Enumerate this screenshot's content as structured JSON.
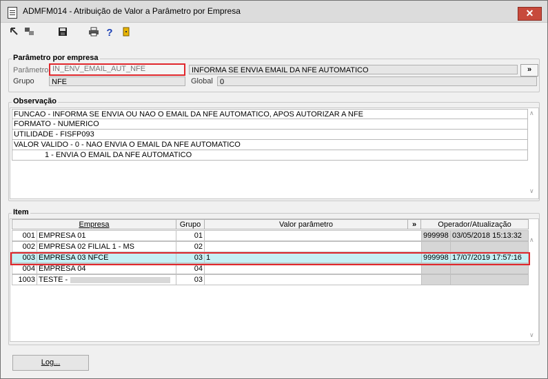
{
  "window": {
    "title": "ADMFM014 - Atribuição de Valor a Parâmetro por Empresa",
    "close_glyph": "✕"
  },
  "toolbar": {
    "icons": [
      "back-icon",
      "forward-icon",
      "save-icon",
      "print-icon",
      "help-icon",
      "exit-icon"
    ]
  },
  "parametro_group": {
    "legend": "Parâmetro por empresa",
    "parametro_label": "Parâmetro",
    "parametro_value": "IN_ENV_EMAIL_AUT_NFE",
    "parametro_desc": "INFORMA SE ENVIA EMAIL DA NFE AUTOMATICO",
    "more_button": "»",
    "grupo_label": "Grupo",
    "grupo_value": "NFE",
    "global_label": "Global",
    "global_value": "0"
  },
  "observacao": {
    "legend": "Observação",
    "lines": [
      "FUNCAO - INFORMA SE ENVIA OU NAO O EMAIL DA NFE AUTOMATICO, APOS AUTORIZAR A NFE",
      "FORMATO - NUMERICO",
      "UTILIDADE - FISFP093",
      "VALOR VALIDO - 0 - NAO ENVIA O EMAIL DA NFE AUTOMATICO",
      "1 - ENVIA O EMAIL DA NFE AUTOMATICO"
    ]
  },
  "item": {
    "legend": "Item",
    "headers": {
      "empresa": "Empresa",
      "grupo": "Grupo",
      "valor": "Valor parâmetro",
      "more": "»",
      "operador": "Operador/Atualização"
    },
    "rows": [
      {
        "code": "001",
        "empresa": "EMPRESA 01",
        "grupo": "01",
        "valor": "",
        "operador": "999998",
        "data": "03/05/2018 15:13:32"
      },
      {
        "code": "002",
        "empresa": "EMPRESA 02 FILIAL 1 - MS",
        "grupo": "02",
        "valor": "",
        "operador": "",
        "data": ""
      },
      {
        "code": "003",
        "empresa": "EMPRESA 03 NFCE",
        "grupo": "03",
        "valor": "1",
        "operador": "999998",
        "data": "17/07/2019 17:57:16"
      },
      {
        "code": "004",
        "empresa": "EMPRESA 04",
        "grupo": "04",
        "valor": "",
        "operador": "",
        "data": ""
      },
      {
        "code": "1003",
        "empresa": "TESTE -",
        "grupo": "03",
        "valor": "",
        "operador": "",
        "data": ""
      }
    ]
  },
  "footer": {
    "log_button": "Log..."
  }
}
